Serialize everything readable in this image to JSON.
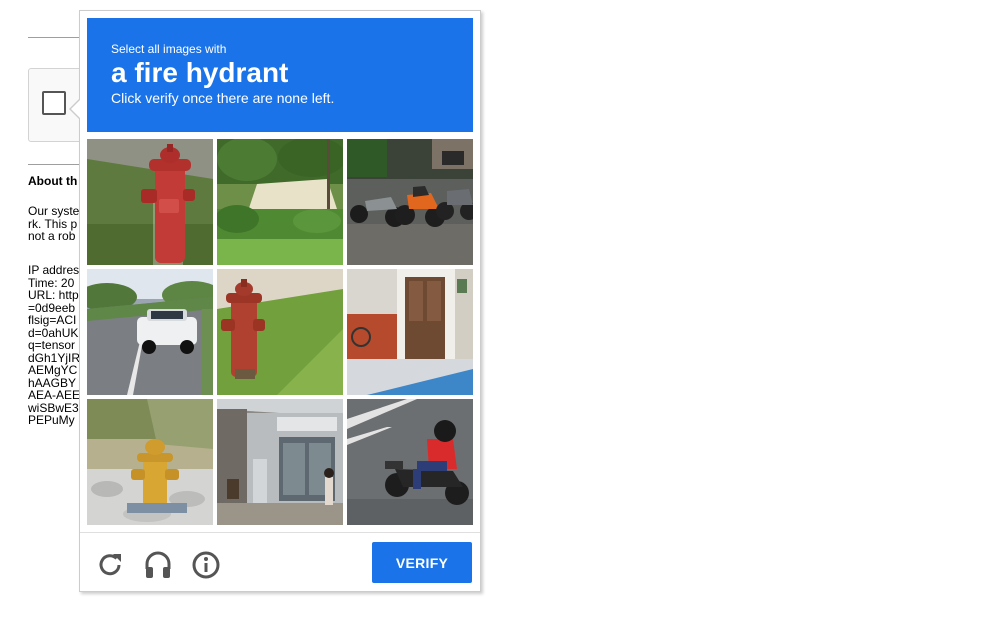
{
  "background_page": {
    "about_title": "About th",
    "about_lines": [
      "Our syste",
      "rk. This p",
      "not a rob"
    ],
    "details_lines": [
      "IP addres",
      "Time: 20",
      "URL: http",
      "=0d9eeb",
      "flsig=ACI",
      "d=0ahUK",
      "q=tensor",
      "dGh1YjIR",
      "AEMgYC",
      "hAAGBY",
      "AEA-AEE",
      "wiSBwE3",
      "PEPuMy"
    ]
  },
  "challenge": {
    "instruction_prefix": "Select all images with",
    "target_object": "a fire hydrant",
    "instruction_suffix": "Click verify once there are none left.",
    "tiles": [
      {
        "label": "fire-hydrant-red-grass"
      },
      {
        "label": "roadside-hedge"
      },
      {
        "label": "parked-motorcycles"
      },
      {
        "label": "road-white-car"
      },
      {
        "label": "fire-hydrant-grass-slope"
      },
      {
        "label": "building-doorway"
      },
      {
        "label": "fire-hydrant-yellow-rocks"
      },
      {
        "label": "station-entrance"
      },
      {
        "label": "motorcyclist-on-road"
      }
    ],
    "icons": {
      "reload": "reload-icon",
      "audio": "headphones-icon",
      "info": "info-icon"
    },
    "verify_label": "VERIFY"
  },
  "colors": {
    "accent": "#1a73e8",
    "icon_gray": "#555555"
  }
}
